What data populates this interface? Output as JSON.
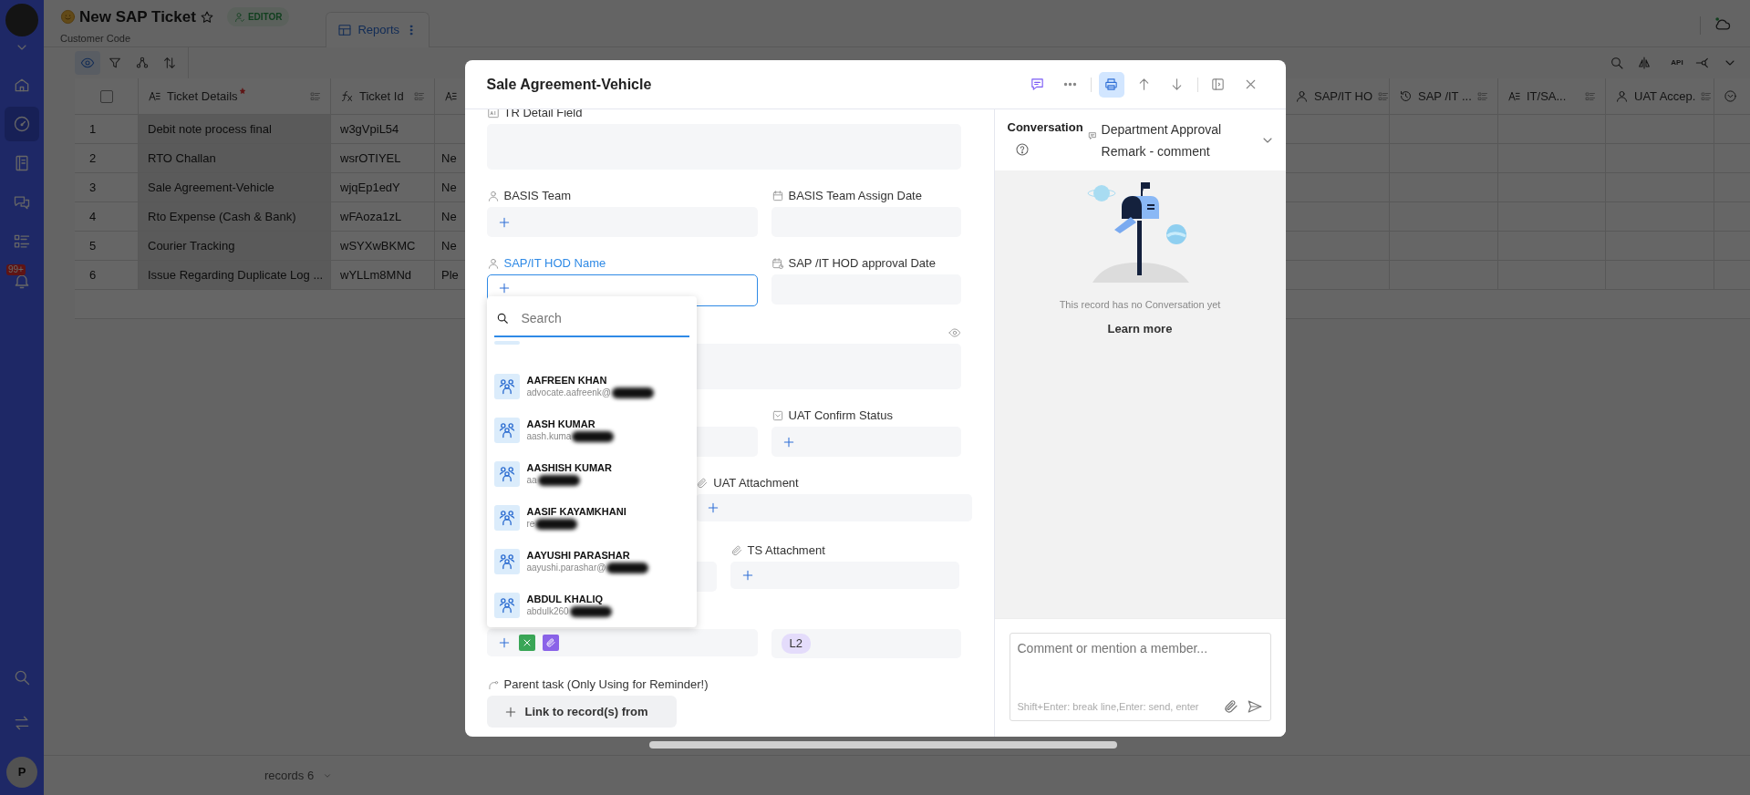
{
  "sidebar": {
    "items": [
      {
        "kind": "home",
        "selected": false
      },
      {
        "kind": "dashboard",
        "selected": true
      },
      {
        "kind": "book",
        "selected": false
      },
      {
        "kind": "chat",
        "selected": false
      },
      {
        "kind": "list",
        "selected": false
      },
      {
        "kind": "bell",
        "selected": false,
        "badge": "99+"
      }
    ],
    "bottom_items": [
      {
        "kind": "search"
      },
      {
        "kind": "swap"
      }
    ],
    "user_initial": "P"
  },
  "header": {
    "title": "New SAP Ticket",
    "role": "EDITOR",
    "subtitle": "Customer Code",
    "views": [
      {
        "label": "Reports",
        "selected": true
      }
    ]
  },
  "toolbar": {
    "tools": [
      {
        "kind": "eye",
        "selected": true
      },
      {
        "kind": "filter",
        "selected": false
      },
      {
        "kind": "group",
        "selected": false
      },
      {
        "kind": "sort",
        "selected": false
      }
    ],
    "right_tools": [
      {
        "kind": "search"
      },
      {
        "kind": "compare"
      },
      {
        "kind": "api",
        "label": "API"
      },
      {
        "kind": "share"
      },
      {
        "kind": "chevron"
      }
    ]
  },
  "table": {
    "select_all": {
      "checked": false
    },
    "columns": [
      {
        "kind": "text",
        "label": "Ticket Details",
        "required": true
      },
      {
        "kind": "formula",
        "label": "Ticket Id"
      },
      {
        "kind": "text"
      },
      {
        "kind": "member",
        "label": "SAP/IT HO"
      },
      {
        "kind": "history",
        "label": "SAP /IT ..."
      },
      {
        "kind": "text",
        "label": "IT/SA..."
      },
      {
        "kind": "member",
        "label": "UAT Accep."
      },
      {
        "kind": "select"
      }
    ],
    "rows": [
      {
        "number": "1",
        "ticket_details": "Debit note process final",
        "ticket_id": "w3gVpiL54"
      },
      {
        "number": "2",
        "ticket_details": "RTO Challan",
        "ticket_id": "wsrOTIYEL",
        "column_3": "Ne"
      },
      {
        "number": "3",
        "ticket_details": "Sale Agreement-Vehicle",
        "ticket_id": "wjqEp1edY",
        "column_3": "Ne"
      },
      {
        "number": "4",
        "ticket_details": "Rto Expense (Cash & Bank)",
        "ticket_id": "wFAoza1zL",
        "column_3": "Ne"
      },
      {
        "number": "5",
        "ticket_details": "Courier Tracking",
        "ticket_id": "wSYXwBKMC",
        "column_3": "Ne"
      },
      {
        "number": "6",
        "ticket_details": "Issue Regarding Duplicate Log ...",
        "ticket_id": "wYLLm8MNd",
        "column_3": "Ple"
      }
    ]
  },
  "footer": {
    "records": "records 6"
  },
  "record_modal": {
    "title": "Sale Agreement-Vehicle",
    "actions": [
      {
        "kind": "comment",
        "selected": false
      },
      {
        "kind": "more",
        "selected": false
      },
      {
        "kind": "print",
        "selected": true
      },
      {
        "kind": "up",
        "selected": false
      },
      {
        "kind": "down",
        "selected": false
      },
      {
        "kind": "panel",
        "selected": false
      },
      {
        "kind": "close",
        "selected": false
      }
    ],
    "form_rows": [
      {
        "fields": [
          {
            "kind": "long_text",
            "label": "TR Detail Field"
          }
        ]
      },
      {
        "fields": [
          {
            "kind": "member",
            "label": "BASIS Team"
          },
          {
            "kind": "date",
            "label": "BASIS Team Assign Date"
          }
        ]
      },
      {
        "fields": [
          {
            "kind": "member",
            "label": "SAP/IT HOD Name",
            "focused": true
          },
          {
            "kind": "date_time",
            "label": "SAP /IT HOD approval Date"
          }
        ]
      },
      {
        "fields": [
          {
            "kind": "long_text",
            "visibility_toggle": true
          }
        ]
      },
      {
        "fields": [
          {
            "kind": "text"
          },
          {
            "kind": "single_select",
            "label": "UAT Confirm Status"
          }
        ]
      },
      {
        "fields": [
          {
            "kind": "text"
          },
          {
            "kind": "attachment",
            "label": "UAT Attachment"
          }
        ]
      },
      {
        "fields": [
          {
            "kind": "text"
          },
          {
            "kind": "attachment",
            "label": "TS Attachment"
          }
        ]
      },
      {
        "fields": [
          {
            "kind": "attachment",
            "files": [
              {
                "kind": "spreadsheet"
              },
              {
                "kind": "link"
              }
            ]
          },
          {
            "kind": "tag",
            "value": "L2"
          }
        ]
      },
      {
        "fields": [
          {
            "kind": "link",
            "label": "Parent task (Only Using for Reminder!)",
            "button": "Link to record(s) from"
          }
        ]
      }
    ],
    "member_picker": {
      "placeholder": "Search",
      "members": [
        {
          "name": "AAFREEN KHAN",
          "email": "advocate.aafreenk@"
        },
        {
          "name": "AASH KUMAR",
          "email": "aash.kuma"
        },
        {
          "name": "AASHISH KUMAR",
          "email": "aa"
        },
        {
          "name": "AASIF KAYAMKHANI",
          "email": "re"
        },
        {
          "name": "AAYUSHI PARASHAR",
          "email": "aayushi.parashar@"
        },
        {
          "name": "ABDUL KHALIQ",
          "email": "abdulk260"
        }
      ]
    },
    "conversation": {
      "title": "Conversation",
      "filter": "Department Approval Remark - comment",
      "empty_text": "This record has no Conversation yet",
      "learn_more": "Learn more",
      "comment_placeholder": "Comment or mention a member...",
      "hint": "Shift+Enter: break line,Enter: send, enter"
    }
  }
}
